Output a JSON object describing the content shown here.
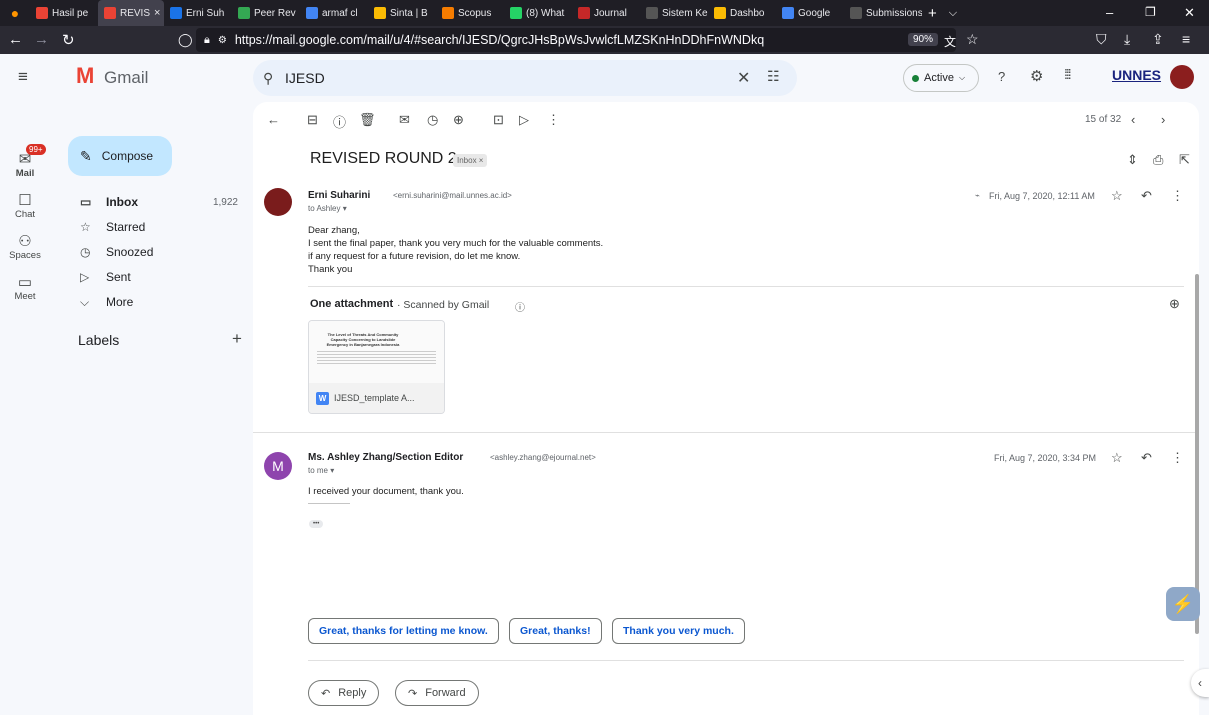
{
  "browser": {
    "tabs": [
      {
        "label": "Hasil pe",
        "color": "#ea4335"
      },
      {
        "label": "REVIS",
        "color": "#ea4335",
        "active": true
      },
      {
        "label": "Erni Suh",
        "color": "#1a73e8"
      },
      {
        "label": "Peer Rev",
        "color": "#34a853"
      },
      {
        "label": "armaf cl",
        "color": "#4285f4"
      },
      {
        "label": "Sinta | B",
        "color": "#fbbc04"
      },
      {
        "label": "Scopus",
        "color": "#f57c00"
      },
      {
        "label": "(8) What",
        "color": "#25d366"
      },
      {
        "label": "Journal",
        "color": "#c62828"
      },
      {
        "label": "Sistem Kepe",
        "color": "#555555"
      },
      {
        "label": "Dashbo",
        "color": "#fbbc04"
      },
      {
        "label": "Google",
        "color": "#4285f4"
      },
      {
        "label": "Submissions",
        "color": "#555555"
      }
    ],
    "active_tab_close": "×",
    "new_tab": "+",
    "url": "https://mail.google.com/mail/u/4/#search/IJESD/QgrcJHsBpWsJvwlcfLMZSKnHnDDhFnWNDkq",
    "zoom": "90%",
    "window_controls": [
      "–",
      "❐",
      "✕"
    ]
  },
  "gmail": {
    "logo": "Gmail",
    "search_value": "IJESD",
    "status": "Active",
    "org_badge": "UNNES",
    "rail": [
      {
        "label": "Mail",
        "badge": "99+"
      },
      {
        "label": "Chat"
      },
      {
        "label": "Spaces"
      },
      {
        "label": "Meet"
      }
    ],
    "compose": "Compose",
    "nav": [
      {
        "label": "Inbox",
        "count": "1,922"
      },
      {
        "label": "Starred",
        "count": ""
      },
      {
        "label": "Snoozed",
        "count": ""
      },
      {
        "label": "Sent",
        "count": ""
      },
      {
        "label": "More",
        "count": ""
      }
    ],
    "labels_heading": "Labels",
    "pager": "15 of 32"
  },
  "thread": {
    "subject": "REVISED ROUND 2",
    "label_chip": "Inbox ×",
    "messages": [
      {
        "sender": "Erni Suharini",
        "email": "<erni.suharini@mail.unnes.ac.id>",
        "to": "to Ashley",
        "date": "Fri, Aug 7, 2020, 12:11 AM",
        "body": [
          "Dear zhang,",
          "I sent the final paper, thank you very much for the valuable comments.",
          "if any request for a future revision, do let me know.",
          "Thank you"
        ]
      },
      {
        "sender": "Ms. Ashley Zhang/Section Editor",
        "email": "<ashley.zhang@ejournal.net>",
        "to": "to me",
        "date": "Fri, Aug 7, 2020, 3:34 PM",
        "avatar_letter": "M",
        "body": [
          "I received your document, thank you.",
          "---------------------"
        ]
      }
    ],
    "attachment_heading": "One attachment",
    "attachment_scan": "· Scanned by Gmail",
    "attachment_name": "IJESD_template A...",
    "attachment_preview_title": "The Level of Threats And Community Capacity Concerning to Landslide Emergency in Banjarnegara Indonesia",
    "smart_replies": [
      "Great, thanks for letting me know.",
      "Great, thanks!",
      "Thank you very much."
    ],
    "reply": "Reply",
    "forward": "Forward",
    "ellipsis": "•••"
  }
}
